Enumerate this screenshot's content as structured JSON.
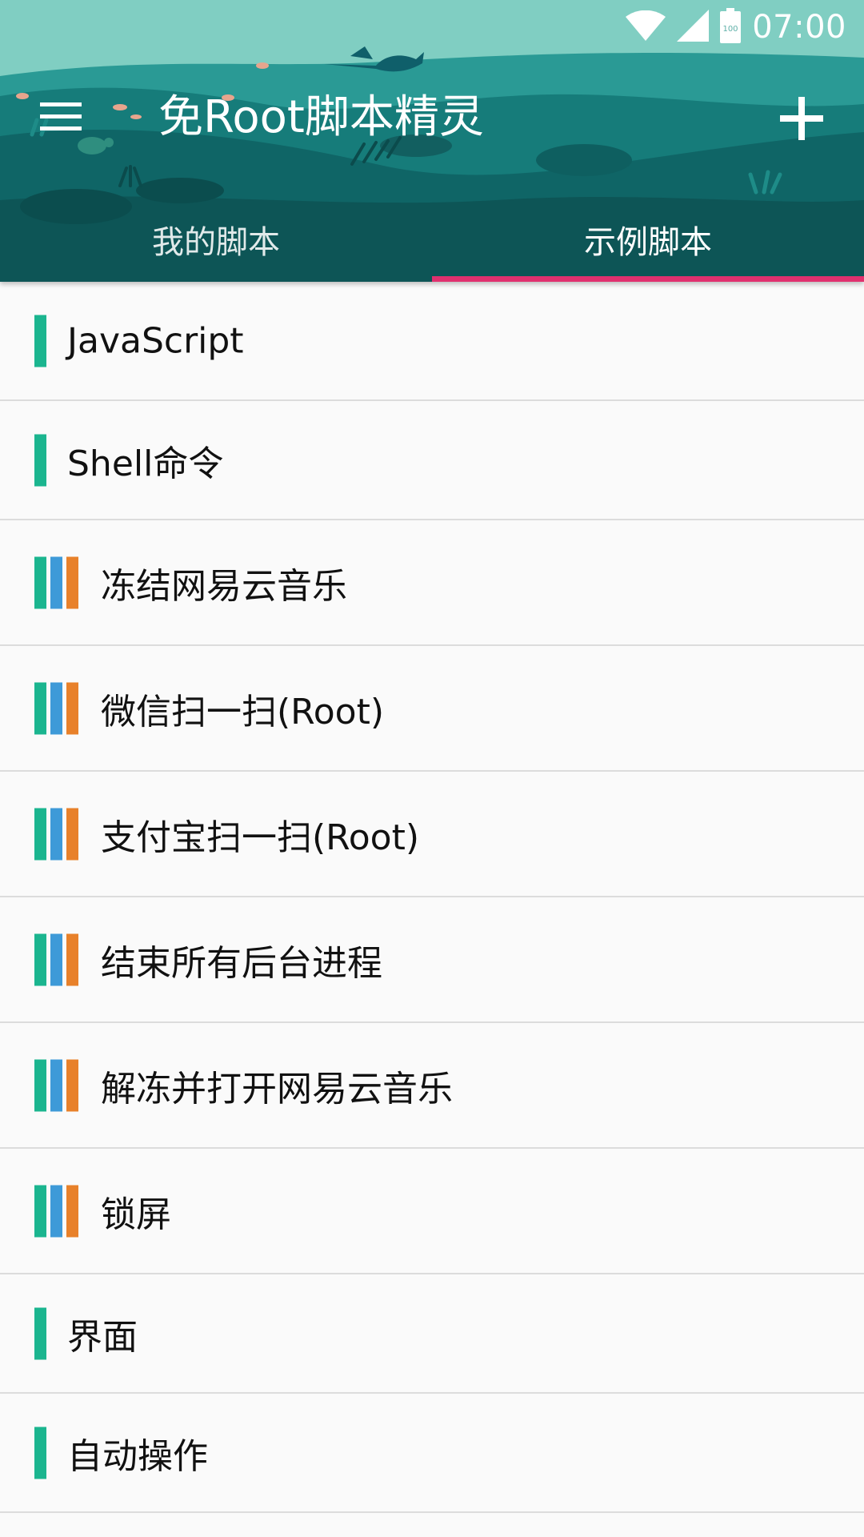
{
  "status_bar": {
    "time": "07:00",
    "battery_level": "100",
    "icons": [
      "wifi-icon",
      "cell-signal-icon",
      "battery-icon"
    ]
  },
  "toolbar": {
    "title": "免Root脚本精灵",
    "menu_icon": "hamburger-menu-icon",
    "add_icon": "plus-icon"
  },
  "tabs": [
    {
      "label": "我的脚本",
      "active": false
    },
    {
      "label": "示例脚本",
      "active": true
    }
  ],
  "colors": {
    "header_teal": "#0f5b5c",
    "header_sky": "#80cec2",
    "tab_indicator": "#e0306e",
    "bar_green": "#1bb58f",
    "bar_blue": "#3e9ad8",
    "bar_orange": "#e8812a"
  },
  "scripts": [
    {
      "name": "JavaScript",
      "bars": [
        "#1bb58f"
      ]
    },
    {
      "name": "Shell命令",
      "bars": [
        "#1bb58f"
      ]
    },
    {
      "name": "冻结网易云音乐",
      "bars": [
        "#1bb58f",
        "#3e9ad8",
        "#e8812a"
      ]
    },
    {
      "name": "微信扫一扫(Root)",
      "bars": [
        "#1bb58f",
        "#3e9ad8",
        "#e8812a"
      ]
    },
    {
      "name": "支付宝扫一扫(Root)",
      "bars": [
        "#1bb58f",
        "#3e9ad8",
        "#e8812a"
      ]
    },
    {
      "name": "结束所有后台进程",
      "bars": [
        "#1bb58f",
        "#3e9ad8",
        "#e8812a"
      ]
    },
    {
      "name": "解冻并打开网易云音乐",
      "bars": [
        "#1bb58f",
        "#3e9ad8",
        "#e8812a"
      ]
    },
    {
      "name": "锁屏",
      "bars": [
        "#1bb58f",
        "#3e9ad8",
        "#e8812a"
      ]
    },
    {
      "name": "界面",
      "bars": [
        "#1bb58f"
      ]
    },
    {
      "name": "自动操作",
      "bars": [
        "#1bb58f"
      ]
    }
  ]
}
